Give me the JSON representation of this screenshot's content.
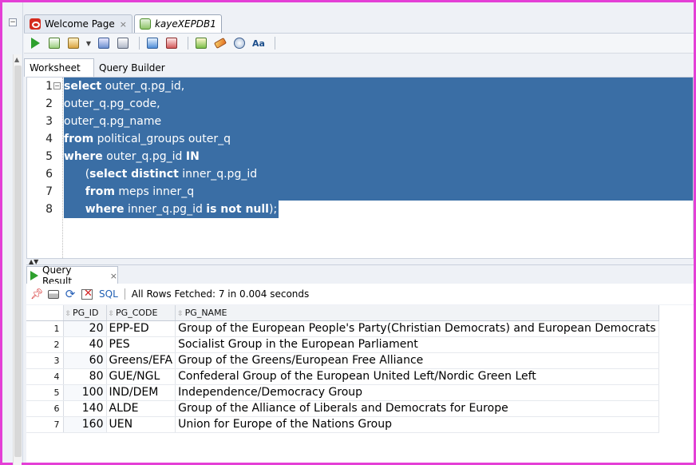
{
  "doc_tabs": [
    {
      "label": "Welcome Page",
      "close": "×"
    },
    {
      "label": "kayeXEPDB1"
    }
  ],
  "worksheet_tabs": [
    "Worksheet",
    "Query Builder"
  ],
  "editor": {
    "line_numbers": [
      "1",
      "2",
      "3",
      "4",
      "5",
      "6",
      "7",
      "8"
    ],
    "lines": [
      [
        {
          "t": "select",
          "kw": true
        },
        {
          "t": " outer_q.pg_id,"
        }
      ],
      [
        {
          "t": "outer_q.pg_code,"
        }
      ],
      [
        {
          "t": "outer_q.pg_name"
        }
      ],
      [
        {
          "t": "from",
          "kw": true
        },
        {
          "t": " political_groups outer_q"
        }
      ],
      [
        {
          "t": "where",
          "kw": true
        },
        {
          "t": " outer_q.pg_id "
        },
        {
          "t": "IN",
          "kw": true
        }
      ],
      [
        {
          "t": "      ("
        },
        {
          "t": "select distinct",
          "kw": true
        },
        {
          "t": " inner_q.pg_id"
        }
      ],
      [
        {
          "t": "      "
        },
        {
          "t": "from",
          "kw": true
        },
        {
          "t": " meps inner_q"
        }
      ],
      [
        {
          "t": "      "
        },
        {
          "t": "where",
          "kw": true
        },
        {
          "t": " inner_q.pg_id "
        },
        {
          "t": "is not null",
          "kw": true
        },
        {
          "t": ");"
        }
      ]
    ]
  },
  "result": {
    "tab_label": "Query Result",
    "tab_close": "×",
    "sql_link": "SQL",
    "status": "All Rows Fetched: 7 in 0.004 seconds",
    "columns": [
      "PG_ID",
      "PG_CODE",
      "PG_NAME"
    ],
    "rows": [
      {
        "n": "1",
        "id": "20",
        "code": "EPP-ED",
        "name": "Group of the European People's Party(Christian Democrats) and European Democrats"
      },
      {
        "n": "2",
        "id": "40",
        "code": "PES",
        "name": "Socialist Group in the European Parliament"
      },
      {
        "n": "3",
        "id": "60",
        "code": "Greens/EFA",
        "name": "Group of the Greens/European Free Alliance"
      },
      {
        "n": "4",
        "id": "80",
        "code": "GUE/NGL",
        "name": "Confederal Group of the European United Left/Nordic Green Left"
      },
      {
        "n": "5",
        "id": "100",
        "code": "IND/DEM",
        "name": "Independence/Democracy Group"
      },
      {
        "n": "6",
        "id": "140",
        "code": "ALDE",
        "name": "Group of the Alliance of Liberals and Democrats for Europe"
      },
      {
        "n": "7",
        "id": "160",
        "code": "UEN",
        "name": "Union for Europe of the Nations Group"
      }
    ]
  },
  "icons": [
    "run-statement-icon",
    "run-script-icon",
    "autotrace-icon",
    "explain-plan-icon",
    "commit-icon",
    "rollback-icon",
    "sql-tuning-icon",
    "clear-icon",
    "history-icon",
    "format-icon",
    "pin-icon",
    "print-icon",
    "refresh-icon",
    "delete-icon"
  ],
  "colors": {
    "frame": "#e43fd6",
    "selection": "#3a6ea5",
    "run": "#2ea02e"
  }
}
